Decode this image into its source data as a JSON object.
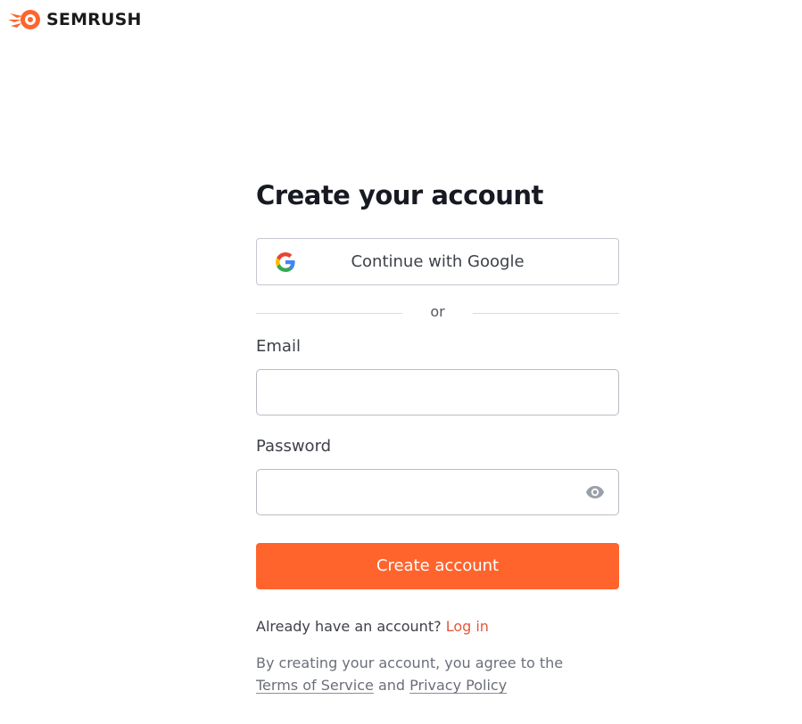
{
  "brand": {
    "name": "SEMRUSH",
    "logo_icon": "semrush-fireball-icon",
    "accent_color": "#ff642d",
    "link_color": "#e5573d"
  },
  "form": {
    "title": "Create your account",
    "google_button_label": "Continue with Google",
    "google_icon": "google-g-icon",
    "divider_text": "or",
    "email_label": "Email",
    "email_value": "",
    "password_label": "Password",
    "password_value": "",
    "password_toggle_icon": "eye-icon",
    "submit_label": "Create account"
  },
  "footer": {
    "login_prompt": "Already have an account?",
    "login_link": "Log in",
    "legal_prefix": "By creating your account, you agree to the",
    "terms_link": "Terms of Service",
    "legal_and": "and",
    "privacy_link": "Privacy Policy"
  }
}
